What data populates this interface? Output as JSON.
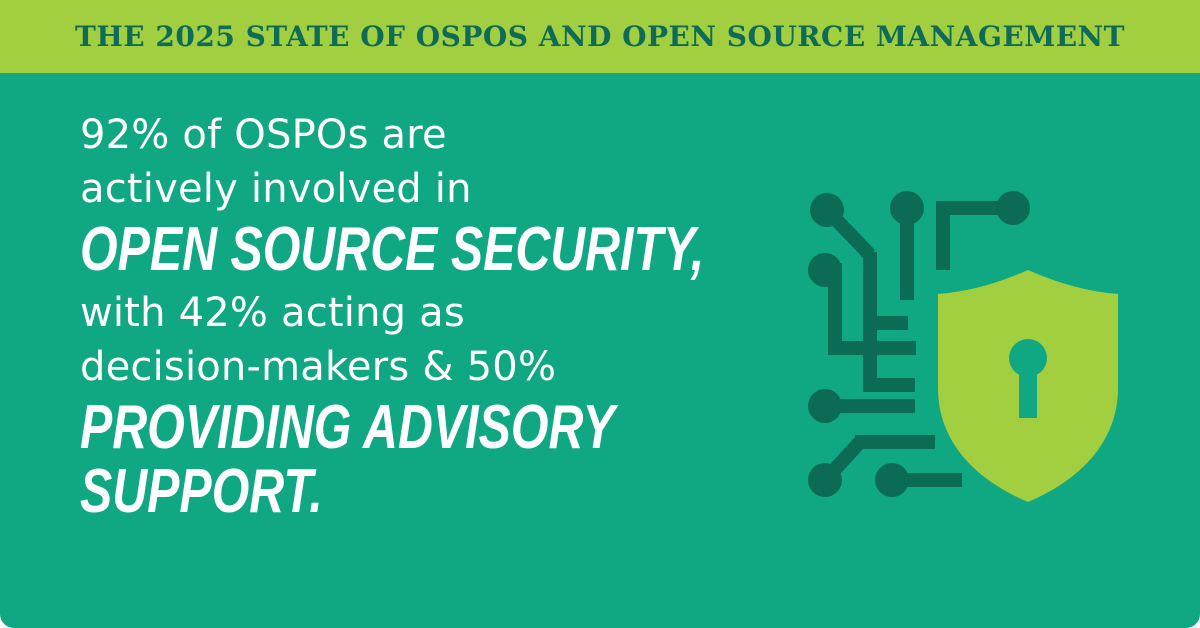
{
  "banner": {
    "title": "THE 2025 STATE OF OSPOS AND OPEN SOURCE MANAGEMENT"
  },
  "statement": {
    "line1": "92% of OSPOs are",
    "line2": "actively involved in",
    "line3": "OPEN SOURCE SECURITY,",
    "line4": "with 42% acting as",
    "line5": "decision-makers & 50%",
    "line6": "PROVIDING ADVISORY",
    "line7": "SUPPORT."
  },
  "colors": {
    "background": "#10a883",
    "banner": "#a2cf3f",
    "banner_text": "#0d6b57",
    "circuit": "#0b6b54",
    "shield": "#a2cf3f",
    "keyhole": "#10a883"
  },
  "icons": {
    "illustration": "shield-lock-circuit-icon"
  }
}
